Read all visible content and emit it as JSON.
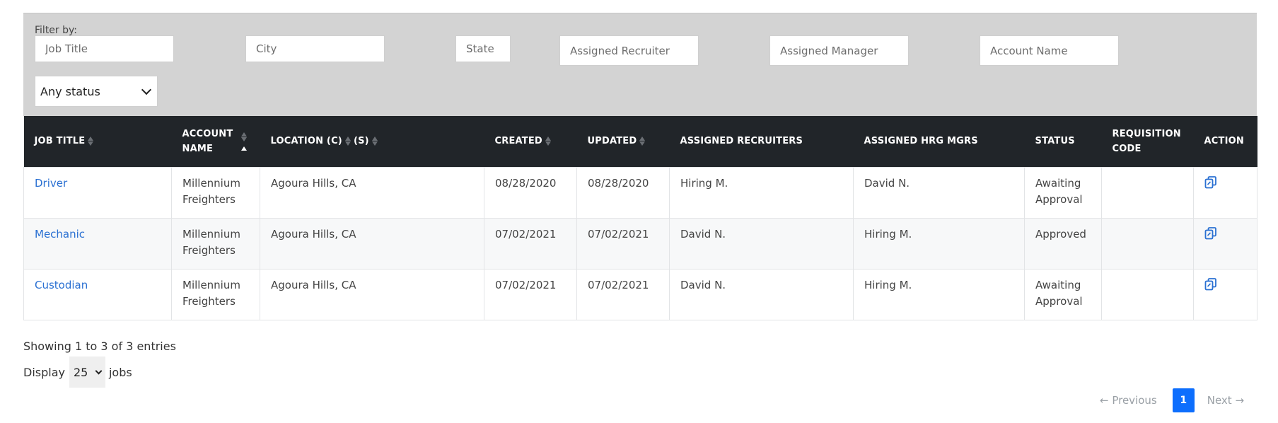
{
  "filters": {
    "label": "Filter by:",
    "job_title_placeholder": "Job Title",
    "city_placeholder": "City",
    "state_placeholder": "State",
    "recruiter_placeholder": "Assigned Recruiter",
    "manager_placeholder": "Assigned Manager",
    "account_placeholder": "Account Name",
    "status_selected": "Any status"
  },
  "table": {
    "headers": {
      "job_title": "JOB TITLE",
      "account_name_1": "ACCOUNT",
      "account_name_2": "NAME",
      "location": "LOCATION (C)",
      "location_s": "(S)",
      "created": "CREATED",
      "updated": "UPDATED",
      "recruiters": "ASSIGNED RECRUITERS",
      "managers": "ASSIGNED HRG MGRS",
      "status": "STATUS",
      "requisition_1": "REQUISITION",
      "requisition_2": "CODE",
      "action": "ACTION"
    },
    "rows": [
      {
        "job_title": "Driver",
        "account_1": "Millennium",
        "account_2": "Freighters",
        "location": "Agoura Hills, CA",
        "created": "08/28/2020",
        "updated": "08/28/2020",
        "recruiters": "Hiring M.",
        "managers": "David N.",
        "status_1": "Awaiting",
        "status_2": "Approval",
        "requisition": ""
      },
      {
        "job_title": "Mechanic",
        "account_1": "Millennium",
        "account_2": "Freighters",
        "location": "Agoura Hills, CA",
        "created": "07/02/2021",
        "updated": "07/02/2021",
        "recruiters": "David N.",
        "managers": "Hiring M.",
        "status_1": "Approved",
        "status_2": "",
        "requisition": ""
      },
      {
        "job_title": "Custodian",
        "account_1": "Millennium",
        "account_2": "Freighters",
        "location": "Agoura Hills, CA",
        "created": "07/02/2021",
        "updated": "07/02/2021",
        "recruiters": "David N.",
        "managers": "Hiring M.",
        "status_1": "Awaiting",
        "status_2": "Approval",
        "requisition": ""
      }
    ]
  },
  "footer": {
    "showing": "Showing 1 to 3 of 3 entries",
    "display_label": "Display",
    "per_page": "25",
    "jobs_label": "jobs",
    "prev": "← Previous",
    "page": "1",
    "next": "Next →"
  },
  "colors": {
    "header_bg": "#212529",
    "filter_bg": "#d3d3d3",
    "link": "#2a70d2",
    "pager_active": "#0d6efd"
  },
  "icons": {
    "action": "copy-icon",
    "sort": "sort-arrows-icon",
    "select": "chevron-down-icon"
  }
}
